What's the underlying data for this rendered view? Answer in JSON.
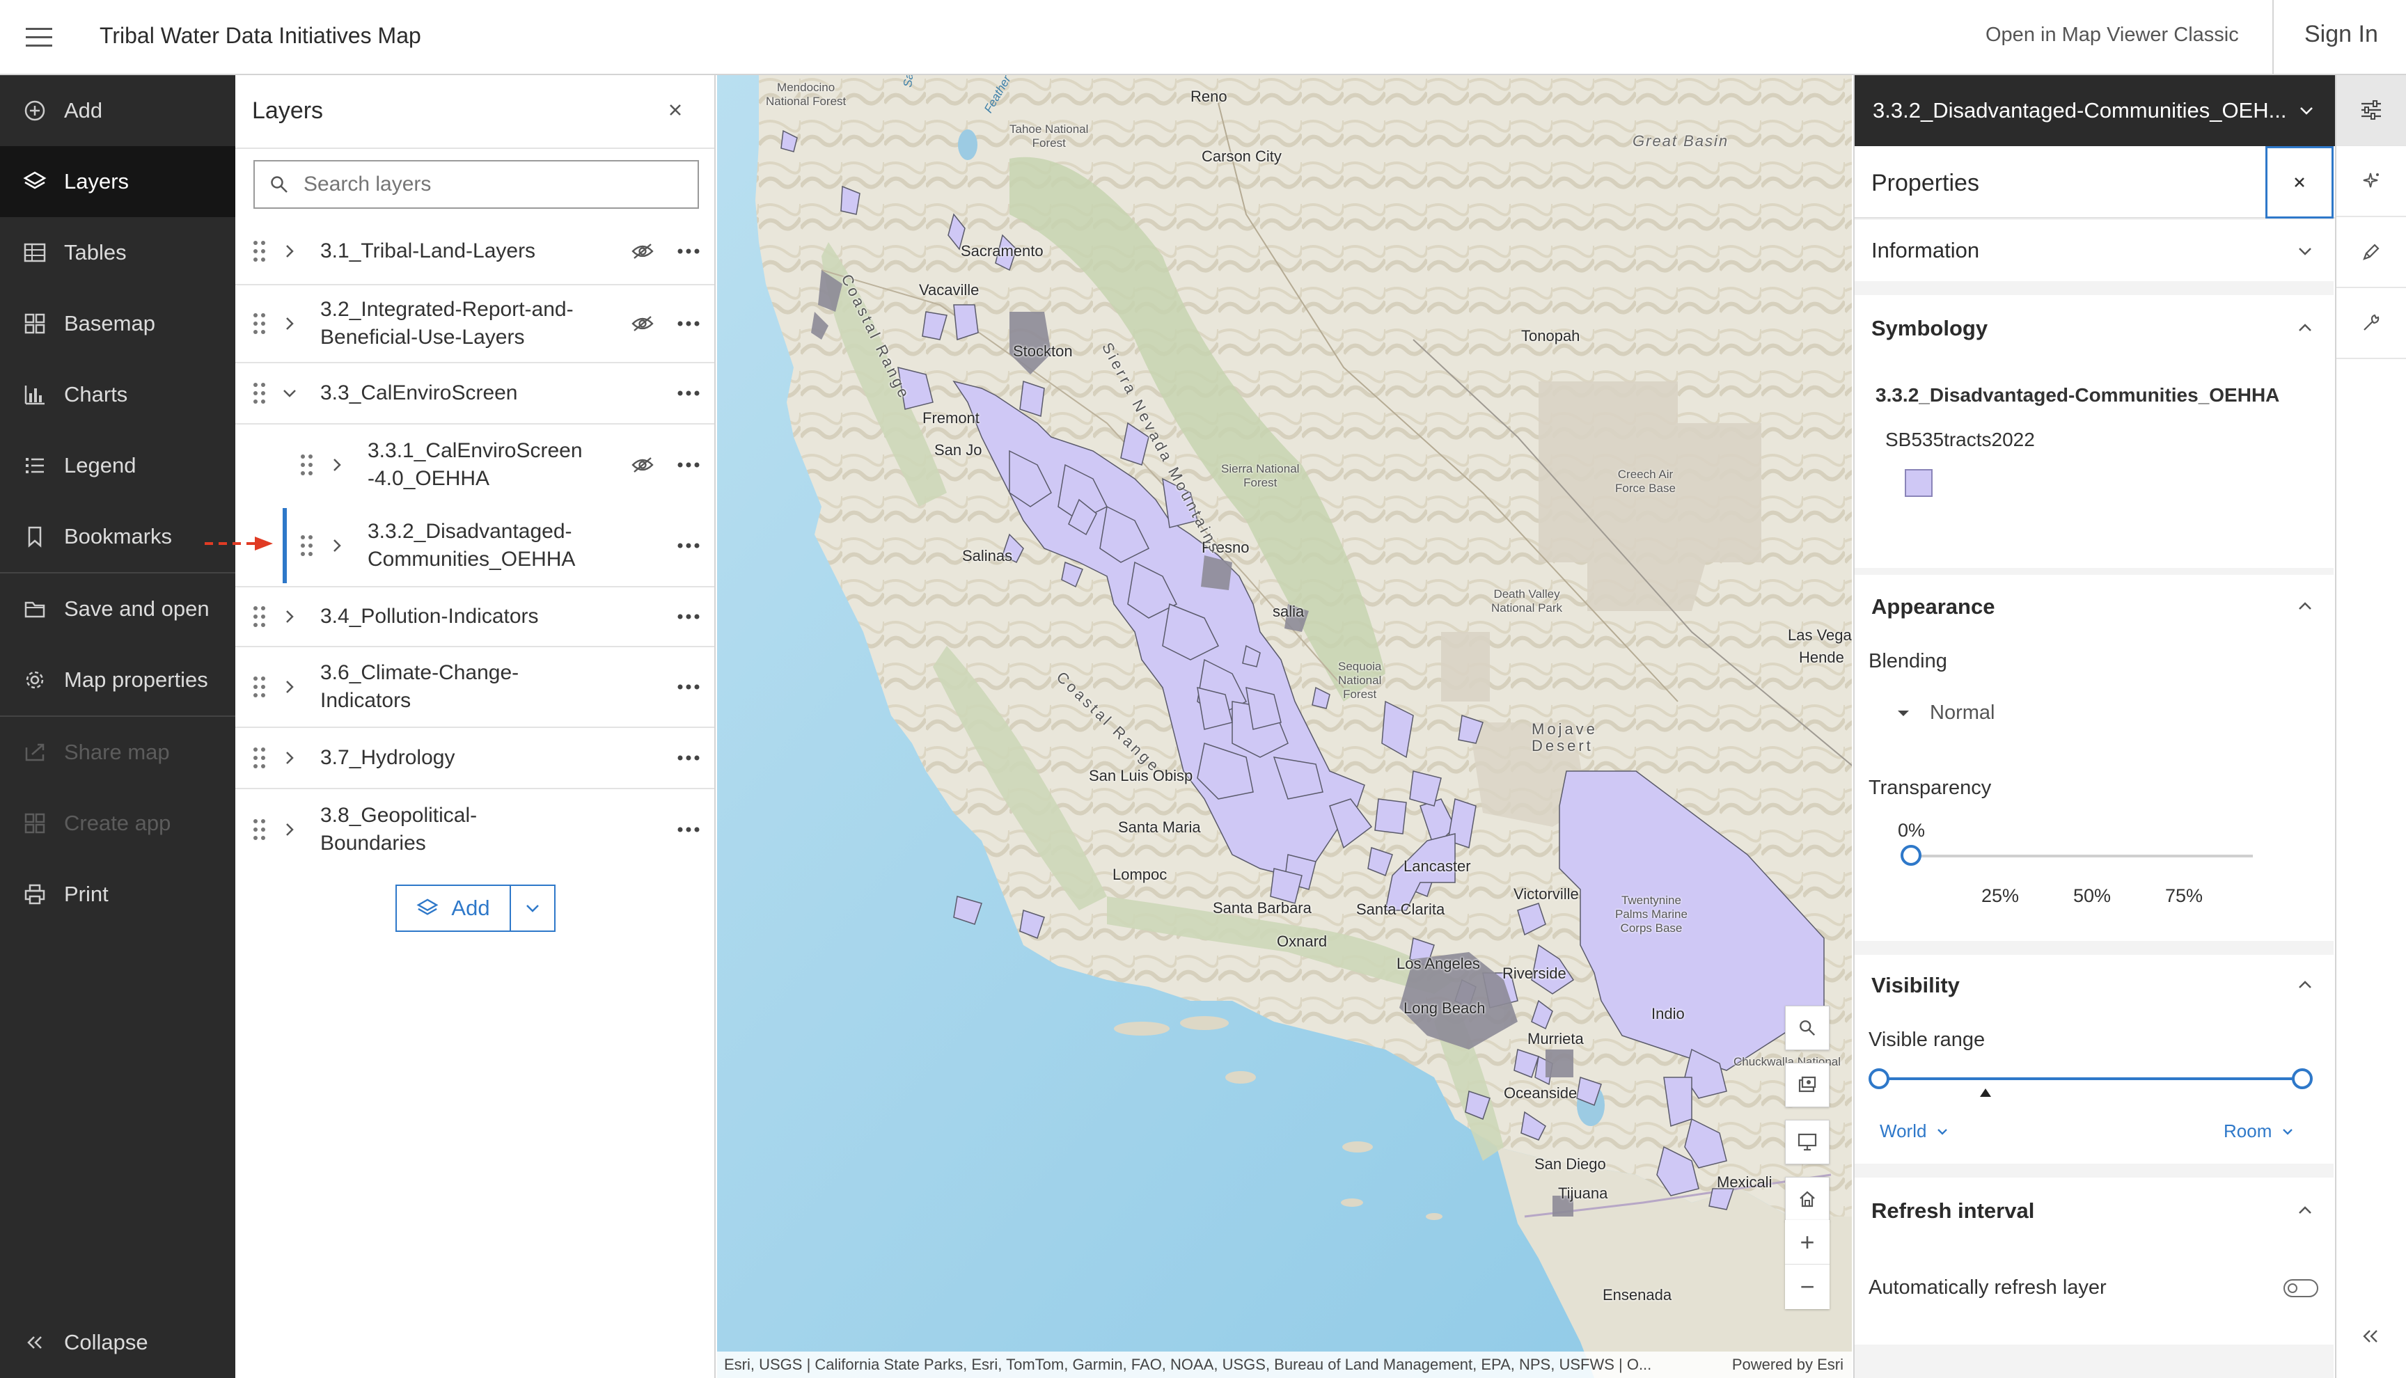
{
  "header": {
    "app_title": "Tribal Water Data Initiatives Map",
    "open_classic": "Open in Map Viewer Classic",
    "sign_in": "Sign In"
  },
  "nav": {
    "items": [
      {
        "label": "Add",
        "icon": "add-circle-icon",
        "state": "normal"
      },
      {
        "label": "Layers",
        "icon": "layers-icon",
        "state": "active"
      },
      {
        "label": "Tables",
        "icon": "table-icon",
        "state": "normal"
      },
      {
        "label": "Basemap",
        "icon": "basemap-grid-icon",
        "state": "normal"
      },
      {
        "label": "Charts",
        "icon": "bar-chart-icon",
        "state": "normal"
      },
      {
        "label": "Legend",
        "icon": "legend-list-icon",
        "state": "normal"
      },
      {
        "label": "Bookmarks",
        "icon": "bookmark-icon",
        "state": "normal"
      },
      {
        "label": "Save and open",
        "icon": "folder-icon",
        "state": "normal"
      },
      {
        "label": "Map properties",
        "icon": "gear-icon",
        "state": "normal"
      },
      {
        "label": "Share map",
        "icon": "share-icon",
        "state": "disabled"
      },
      {
        "label": "Create app",
        "icon": "apps-grid-icon",
        "state": "disabled"
      },
      {
        "label": "Print",
        "icon": "printer-icon",
        "state": "normal"
      }
    ],
    "collapse": "Collapse"
  },
  "layers_panel": {
    "title": "Layers",
    "search_placeholder": "Search layers",
    "rows": [
      {
        "label": "3.1_Tribal-Land-Layers",
        "expanded": false,
        "hidden": true
      },
      {
        "label": "3.2_Integrated-Report-and-\nBeneficial-Use-Layers",
        "expanded": false,
        "hidden": true
      },
      {
        "label": "3.3_CalEnviroScreen",
        "expanded": true,
        "hidden": false
      },
      {
        "label": "3.3.1_CalEnviroScreen\n-4.0_OEHHA",
        "expanded": false,
        "hidden": true,
        "child": true
      },
      {
        "label": "3.3.2_Disadvantaged-\nCommunities_OEHHA",
        "expanded": false,
        "hidden": false,
        "child": true,
        "selected": true
      },
      {
        "label": "3.4_Pollution-Indicators",
        "expanded": false,
        "hidden": false
      },
      {
        "label": "3.6_Climate-Change-\nIndicators",
        "expanded": false,
        "hidden": false
      },
      {
        "label": "3.7_Hydrology",
        "expanded": false,
        "hidden": false
      },
      {
        "label": "3.8_Geopolitical-\nBoundaries",
        "expanded": false,
        "hidden": false
      }
    ],
    "add_label": "Add"
  },
  "map": {
    "labels": {
      "reno": "Reno",
      "carson_city": "Carson City",
      "great_basin": "Great Basin",
      "sacramento": "Sacramento",
      "vacaville": "Vacaville",
      "stockton": "Stockton",
      "tonopah": "Tonopah",
      "fremont": "Fremont",
      "san_jose": "San Jo",
      "salinas": "Salinas",
      "fresno": "Fresno",
      "visalia": "salia",
      "las_vegas": "Las Vega",
      "henderson": "Hende",
      "san_luis_obispo": "San Luis Obisp",
      "santa_maria": "Santa Maria",
      "lompoc": "Lompoc",
      "santa_barbara": "Santa Barbara",
      "oxnard": "Oxnard",
      "santa_clarita": "Santa Clarita",
      "lancaster": "Lancaster",
      "victorville": "Victorville",
      "los_angeles": "Los Angeles",
      "riverside": "Riverside",
      "long_beach": "Long Beach",
      "indio": "Indio",
      "murrieta": "Murrieta",
      "oceanside": "Oceanside",
      "san_diego": "San Diego",
      "tijuana": "Tijuana",
      "mexicali": "Mexicali",
      "ensenada": "Ensenada",
      "mojave_desert": "Mojave\nDesert",
      "mendocino_nf": "Mendocino\nNational Forest",
      "tahoe_nf": "Tahoe National\nForest",
      "sierra_nf": "Sierra National\nForest",
      "sequoia_nf": "Sequoia\nNational\nForest",
      "death_valley": "Death Valley\nNational Park",
      "creech": "Creech Air\nForce Base",
      "twentynine_palms": "Twentynine\nPalms Marine\nCorps Base",
      "chuckwalla": "Chuckwalla National",
      "sierra_nevada": "Sierra Nevada Mountains",
      "coastal_range_n": "Coastal Range",
      "coastal_range_s": "Coastal Range",
      "sacramento_river": "Sacramento",
      "feather": "Feather"
    },
    "attribution": "Esri, USGS | California State Parks, Esri, TomTom, Garmin, FAO, NOAA, USGS, Bureau of Land Management, EPA, NPS, USFWS | O...",
    "powered_by": "Powered by Esri",
    "zoom_in": "+",
    "zoom_out": "−"
  },
  "properties": {
    "layer_select": "3.3.2_Disadvantaged-Communities_OEH...",
    "title": "Properties",
    "information": "Information",
    "symbology": {
      "heading": "Symbology",
      "layer_name": "3.3.2_Disadvantaged-Communities_OEHHA",
      "field": "SB535tracts2022",
      "swatch_color": "#cfc8f5"
    },
    "appearance": {
      "heading": "Appearance",
      "blending_label": "Blending",
      "blending_value": "Normal",
      "transparency_label": "Transparency",
      "transparency_value": "0%",
      "transparency": 0,
      "ticks": [
        "25%",
        "50%",
        "75%"
      ]
    },
    "visibility": {
      "heading": "Visibility",
      "range_label": "Visible range",
      "min_scale": "World",
      "max_scale": "Room"
    },
    "refresh": {
      "heading": "Refresh interval",
      "auto_label": "Automatically refresh layer",
      "auto_on": false
    }
  },
  "colors": {
    "accent": "#2e78c9",
    "nav_bg": "#2b2b2b",
    "polygon_fill": "#cfc8f5",
    "polygon_stroke": "#5a5a6a",
    "annotation_arrow": "#e03b24"
  }
}
